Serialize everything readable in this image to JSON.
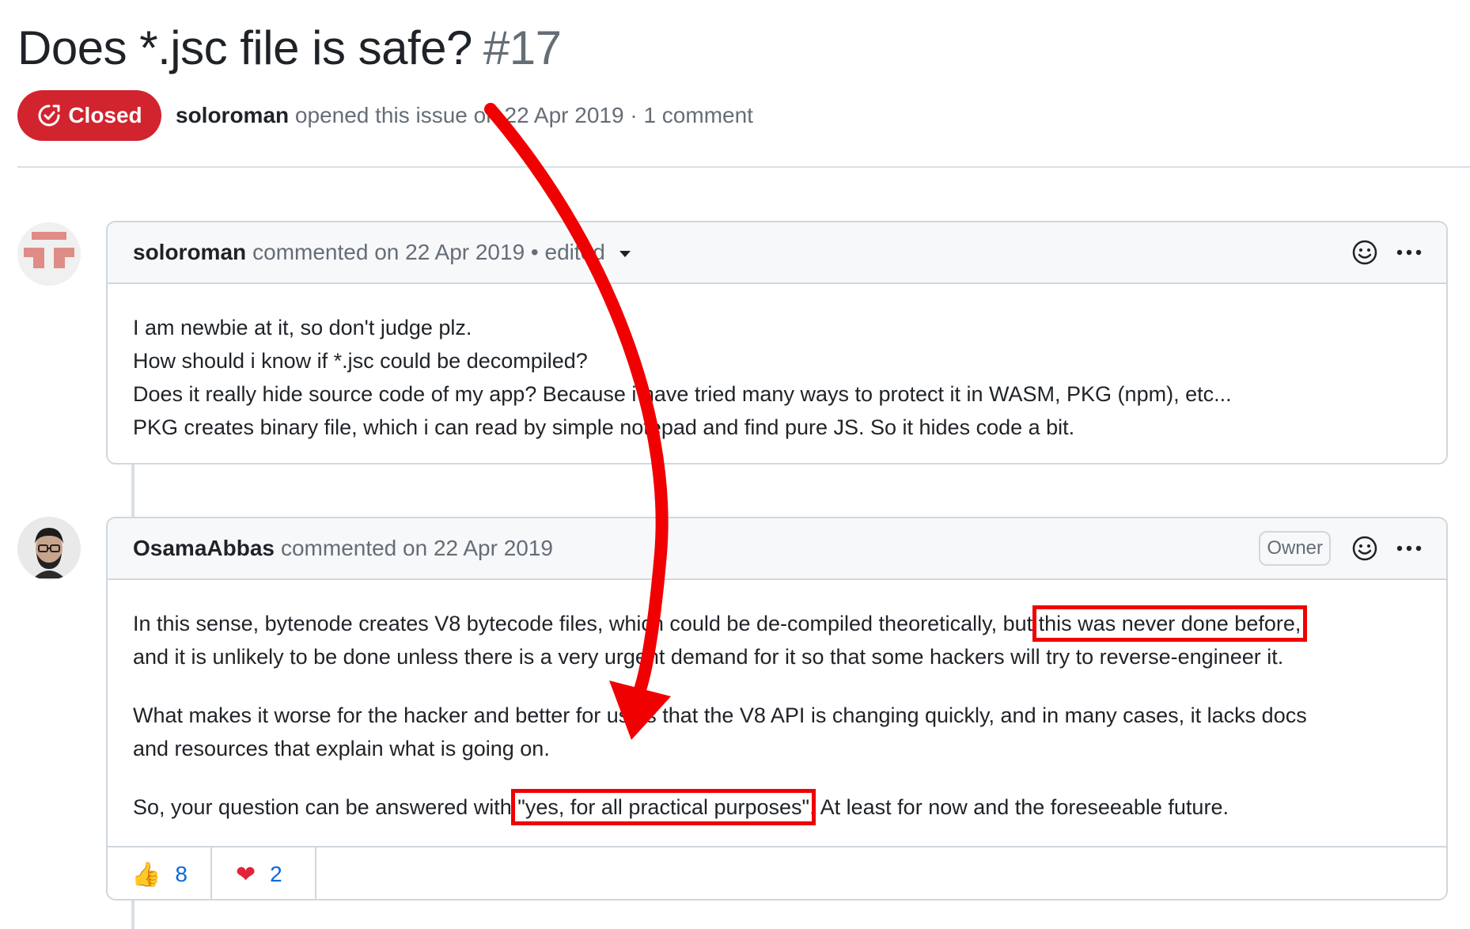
{
  "issue": {
    "title": "Does *.jsc file is safe?",
    "number": "#17",
    "state": "Closed",
    "author": "soloroman",
    "meta": "opened this issue on 22 Apr 2019 · 1 comment"
  },
  "comments": [
    {
      "author": "soloroman",
      "meta": "commented on 22 Apr 2019 • edited",
      "lines": [
        "I am newbie at it, so don't judge plz.",
        "How should i know if *.jsc could be decompiled?",
        "Does it really hide source code of my app? Because i have tried many ways to protect it in WASM, PKG (npm), etc...",
        "PKG creates binary file, which i can read by simple notepad and find pure JS. So it hides code a bit."
      ]
    },
    {
      "author": "OsamaAbbas",
      "meta": "commented on 22 Apr 2019",
      "badge": "Owner",
      "p1_before": "In this sense, bytenode creates V8 bytecode files, which could be de-compiled theoretically, but ",
      "p1_highlight": "this was never done before,",
      "p1_after": "and it is unlikely to be done unless there is a very urgent demand for it so that some hackers will try to reverse-engineer it.",
      "p2_line1": "What makes it worse for the hacker and better for us, is that the V8 API is changing quickly, and in many cases, it lacks docs",
      "p2_line2": "and resources that explain what is going on.",
      "p3_before": "So, your question can be answered with ",
      "p3_highlight": "\"yes, for all practical purposes\"",
      "p3_after": ". At least for now and the foreseeable future.",
      "reactions": [
        {
          "emoji": "👍",
          "count": "8"
        },
        {
          "emoji": "❤",
          "count": "2"
        }
      ]
    }
  ],
  "icons": {
    "state": "issue-closed-icon",
    "add_reaction": "smiley-icon",
    "more": "kebab-horizontal-icon"
  },
  "colors": {
    "closed_badge": "#d1242f",
    "annotation": "#f00000",
    "link": "#0969da"
  }
}
